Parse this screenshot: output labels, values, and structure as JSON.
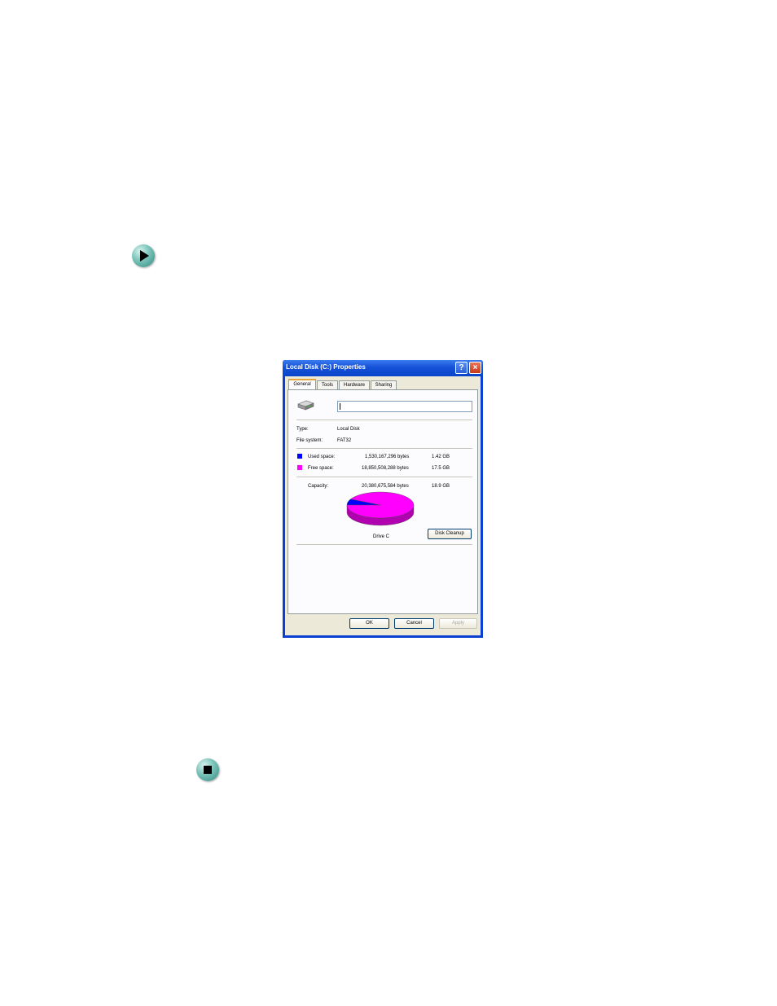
{
  "dialog": {
    "title": "Local Disk (C:) Properties",
    "help_label": "?",
    "close_label": "×",
    "tabs": [
      {
        "label": "General",
        "active": true
      },
      {
        "label": "Tools",
        "active": false
      },
      {
        "label": "Hardware",
        "active": false
      },
      {
        "label": "Sharing",
        "active": false
      }
    ],
    "volume_label_value": "",
    "type_label": "Type:",
    "type_value": "Local Disk",
    "fs_label": "File system:",
    "fs_value": "FAT32",
    "used": {
      "label": "Used space:",
      "bytes": "1,530,167,296 bytes",
      "size": "1.42 GB",
      "color": "#0000ff"
    },
    "free": {
      "label": "Free space:",
      "bytes": "18,850,508,288 bytes",
      "size": "17.5 GB",
      "color": "#ff00ff"
    },
    "capacity": {
      "label": "Capacity:",
      "bytes": "20,380,675,584 bytes",
      "size": "18.9 GB"
    },
    "drive_label": "Drive C",
    "disk_cleanup_label": "Disk Cleanup",
    "ok_label": "OK",
    "cancel_label": "Cancel",
    "apply_label": "Apply"
  },
  "chart_data": {
    "type": "pie",
    "categories": [
      "Used space",
      "Free space"
    ],
    "values": [
      1530167296,
      18850508288
    ],
    "colors": [
      "#0000ff",
      "#ff00ff"
    ]
  },
  "icons": {
    "page_bullet_start": "play-arrow-icon",
    "page_bullet_end": "stop-square-icon"
  }
}
